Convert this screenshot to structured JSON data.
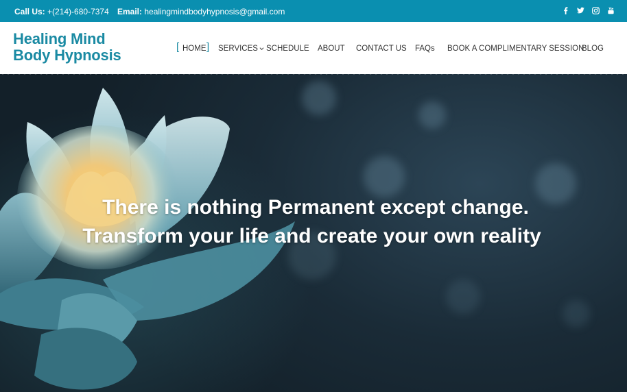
{
  "topbar": {
    "phone_label": "Call Us:",
    "phone_value": "+(214)-680-7374",
    "email_label": "Email:",
    "email_value": "healingmindbodyhypnosis@gmail.com",
    "socials": [
      "facebook-icon",
      "twitter-icon",
      "instagram-icon",
      "youtube-icon"
    ]
  },
  "brand": {
    "line1": "Healing Mind",
    "line2": "Body Hypnosis"
  },
  "nav": {
    "items": [
      {
        "label": "HOME",
        "active": true
      },
      {
        "label": "SERVICES",
        "has_dropdown": true
      },
      {
        "label": "SCHEDULE"
      },
      {
        "label": "ABOUT"
      },
      {
        "label": "CONTACT US"
      },
      {
        "label": "FAQs"
      },
      {
        "label": "BOOK A COMPLIMENTARY SESSION"
      },
      {
        "label": "BLOG"
      }
    ],
    "active_bracket_open": "[",
    "active_bracket_close": "]"
  },
  "hero": {
    "line1": "There is nothing Permanent except change.",
    "line2": "Transform your life and create your own reality"
  },
  "colors": {
    "accent": "#0a8fb0",
    "brand_text": "#1a8aa3",
    "hero_bg": "#1a2b37"
  }
}
